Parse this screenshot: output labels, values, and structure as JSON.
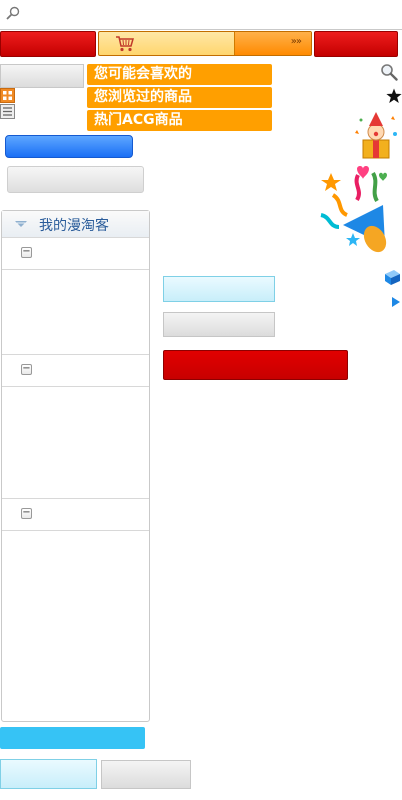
{
  "search": {
    "icon": "search-icon"
  },
  "header": {
    "cart_icon": "cart-icon",
    "arrows_text": "»»"
  },
  "menu": {
    "items": [
      {
        "label": "您可能会喜欢的"
      },
      {
        "label": "您浏览过的商品"
      },
      {
        "label": "热门ACG商品"
      }
    ]
  },
  "panel": {
    "title": "我的漫淘客",
    "sections": [
      {
        "toggle": "−"
      },
      {
        "toggle": "−"
      },
      {
        "toggle": "−"
      }
    ]
  },
  "colors": {
    "red": "#d40000",
    "orange": "#ff9f00",
    "blue": "#1a6ff5",
    "cyan": "#36c3f5",
    "panel_title": "#2a5c9a"
  },
  "icons": [
    "search-icon",
    "star-icon",
    "clown-gift-icon",
    "party-decoration-icon",
    "gift-box-icon",
    "play-arrow-icon",
    "grid-view-icon",
    "list-view-icon"
  ]
}
